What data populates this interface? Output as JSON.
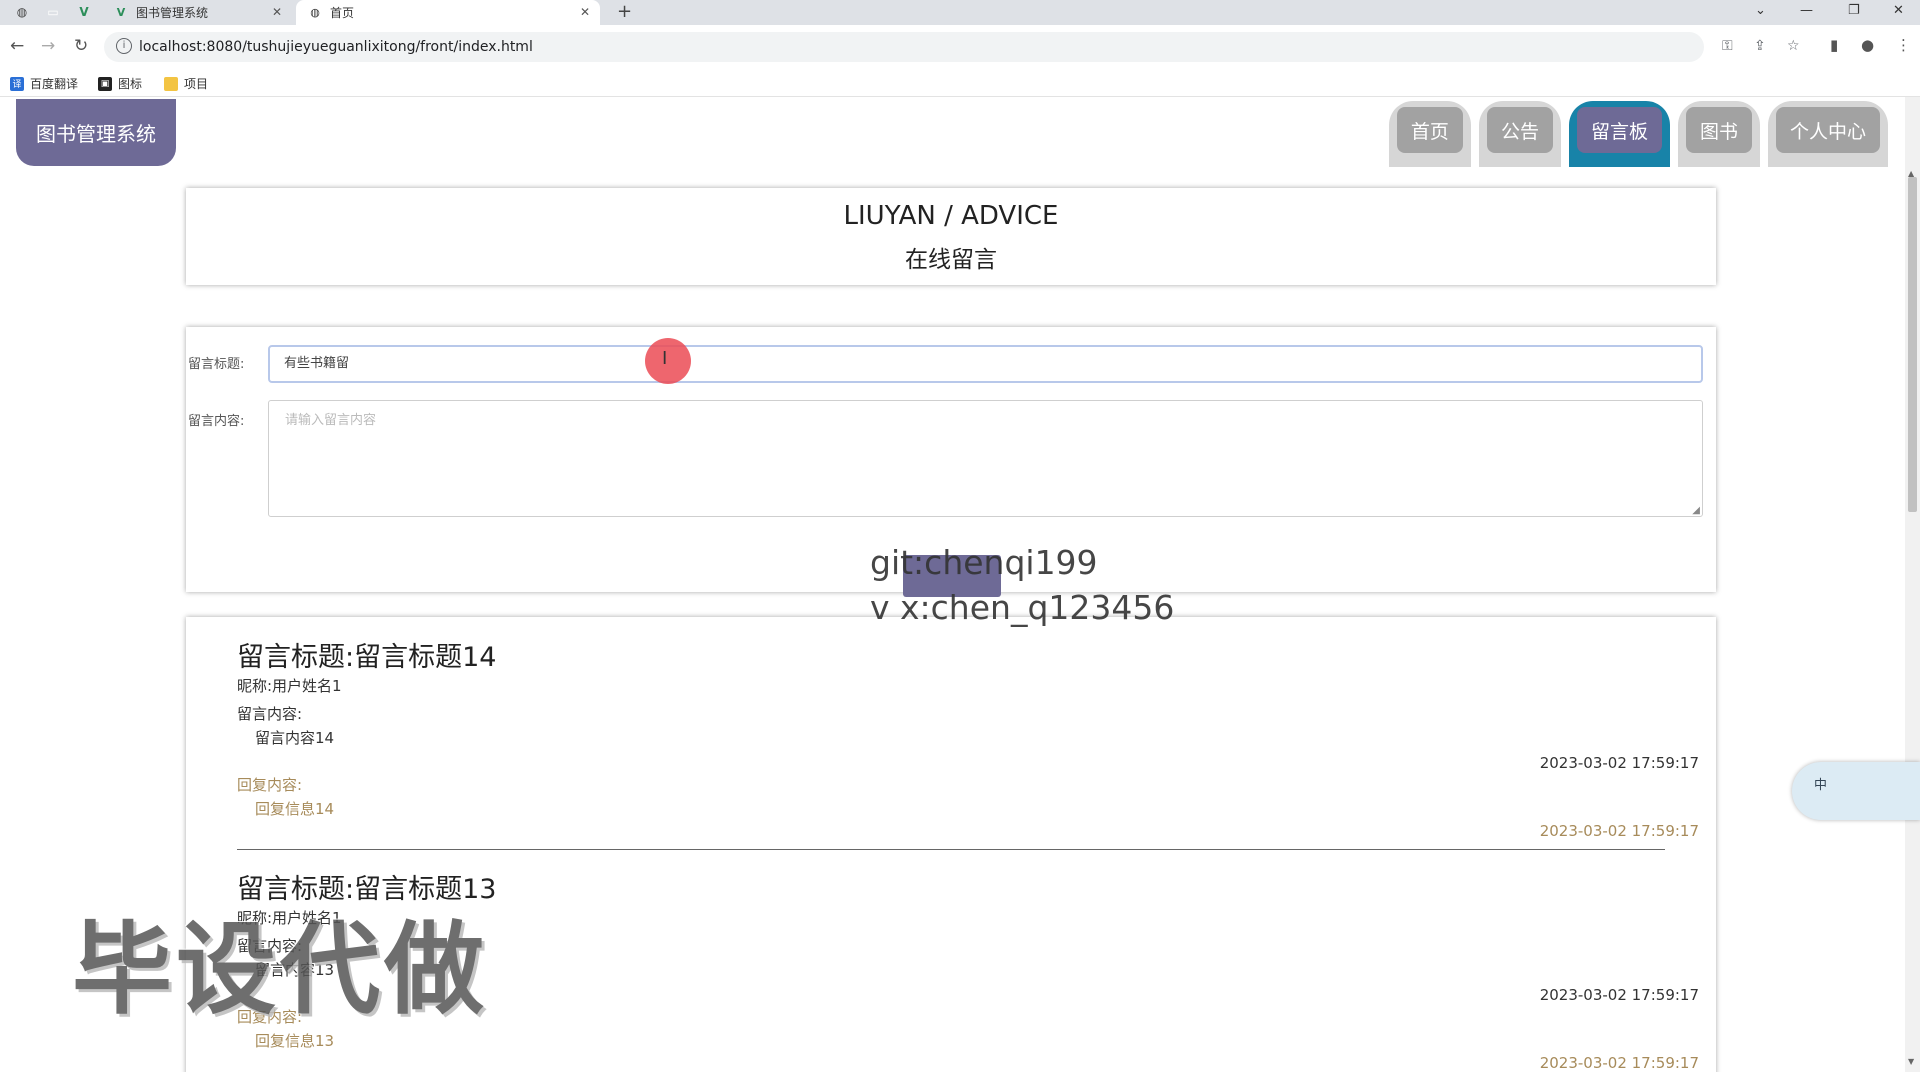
{
  "browser": {
    "tabs": [
      {
        "title": "图书管理系统",
        "favicon": "vue-icon"
      },
      {
        "title": "首页",
        "favicon": "globe-icon"
      }
    ],
    "url": "localhost:8080/tushujieyueguanlixitong/front/index.html",
    "bookmarks": [
      {
        "label": "百度翻译",
        "color": "#2a6fd6"
      },
      {
        "label": "图标",
        "color": "#222222"
      },
      {
        "label": "项目",
        "color": "#f3c443"
      }
    ]
  },
  "site": {
    "logo": "图书管理系统",
    "nav": [
      {
        "label": "首页",
        "active": false
      },
      {
        "label": "公告",
        "active": false
      },
      {
        "label": "留言板",
        "active": true
      },
      {
        "label": "图书",
        "active": false
      },
      {
        "label": "个人中心",
        "active": false
      }
    ]
  },
  "header": {
    "title_en": "LIUYAN / ADVICE",
    "title_cn": "在线留言"
  },
  "form": {
    "title_label": "留言标题:",
    "title_value": "有些书籍留",
    "content_label": "留言内容:",
    "content_placeholder": "请输入留言内容"
  },
  "overlay": {
    "line1": "git:chenqi199",
    "line2": "v x:chen_q123456",
    "watermark": "毕设代做"
  },
  "messages": [
    {
      "title": "留言标题:留言标题14",
      "nickname": "昵称:用户姓名1",
      "content_label": "留言内容:",
      "content": "留言内容14",
      "time": "2023-03-02 17:59:17",
      "reply_label": "回复内容:",
      "reply": "回复信息14",
      "reply_time": "2023-03-02 17:59:17"
    },
    {
      "title": "留言标题:留言标题13",
      "nickname": "昵称:用户姓名1",
      "content_label": "留言内容:",
      "content": "留言内容13",
      "time": "2023-03-02 17:59:17",
      "reply_label": "回复内容:",
      "reply": "回复信息13",
      "reply_time": "2023-03-02 17:59:17"
    }
  ],
  "ime": {
    "label": "中"
  },
  "colors": {
    "brand": "#6e6a96",
    "nav_active_outer": "#1883a8",
    "reply": "#a78b5a"
  }
}
